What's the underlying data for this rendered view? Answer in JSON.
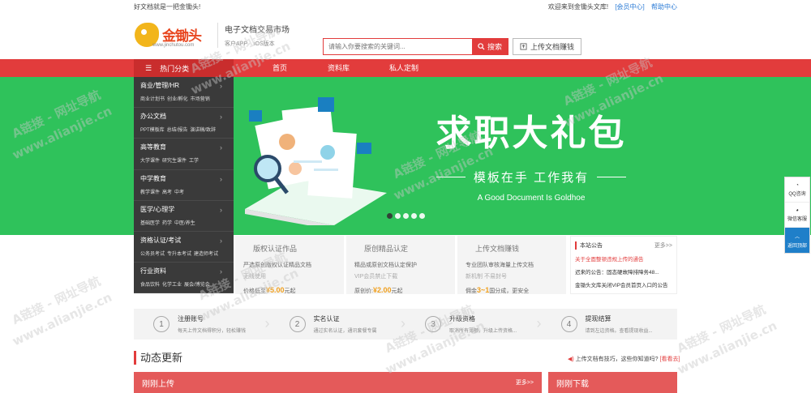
{
  "topbar": {
    "left": "好文档就是一把金锄头!",
    "welcome": "欢迎来到金锄头文库!",
    "member": "[会员中心]",
    "help": "帮助中心"
  },
  "logo": {
    "name": "金锄头",
    "url": "www.jinchutou.com"
  },
  "slogan": {
    "title": "电子文档交易市场",
    "app": "客户APP",
    "ios": "iOS版本"
  },
  "search": {
    "placeholder": "请输入你要搜索的关键词...",
    "button": "搜索"
  },
  "upload": {
    "label": "上传文档赚钱"
  },
  "nav": {
    "category": "热门分类",
    "items": [
      "首页",
      "资料库",
      "私人定制"
    ]
  },
  "sidebar": [
    {
      "title": "商业/管理/HR",
      "subs": [
        "商业计划书",
        "创业/孵化",
        "市场营销"
      ]
    },
    {
      "title": "办公文档",
      "subs": [
        "PPT模板库",
        "总结/报告",
        "演讲稿/致辞"
      ]
    },
    {
      "title": "高等教育",
      "subs": [
        "大学课件",
        "研究生课件",
        "工学"
      ]
    },
    {
      "title": "中学教育",
      "subs": [
        "教学课件",
        "高考",
        "中考"
      ]
    },
    {
      "title": "医学/心理学",
      "subs": [
        "基础医学",
        "药学",
        "中医/养生"
      ]
    },
    {
      "title": "资格认证/考试",
      "subs": [
        "公务员考试",
        "专升本考试",
        "建造师考试"
      ]
    },
    {
      "title": "行业资料",
      "subs": [
        "食品饮料",
        "化学工业",
        "展会/博览会"
      ]
    }
  ],
  "banner": {
    "title": "求职大礼包",
    "subtitle": "模板在手  工作我有",
    "english": "A Good Document Is Goldhoe",
    "dots": 5,
    "active_dot": 0
  },
  "features": [
    {
      "title": "版权认证作品",
      "line1": "严选原创版权认证精品文档",
      "line2": "无线使用",
      "price_label": "价格低至",
      "price": "¥5.00",
      "unit": "元起"
    },
    {
      "title": "原创精品认定",
      "line1": "精品或原创文档认定保护",
      "line2": "VIP会员禁止下载",
      "price_label": "原创价:",
      "price": "¥2.00",
      "unit": "元起"
    },
    {
      "title": "上传文档赚钱",
      "line1": "专业团队审核海量上传文档",
      "line2": "新机制  不易封号",
      "price_label": "佣金",
      "price": "3~1",
      "unit": "国分成，更安全"
    }
  ],
  "notice": {
    "title": "本站公告",
    "more": "更多>>",
    "items": [
      "关于全面整顿违规上传的通告",
      "迟来的公告：固态硬故障排障务48...",
      "金锄头文库关闭VIP会员首页入口的公告"
    ]
  },
  "steps": [
    {
      "num": "1",
      "title": "注册账号",
      "desc": "每天上传文档得积分，轻松赚钱"
    },
    {
      "num": "2",
      "title": "实名认证",
      "desc": "通过实名认证，通讯套餐专属"
    },
    {
      "num": "3",
      "title": "升级资格",
      "desc": "取消所有薄额，升级上传资格..."
    },
    {
      "num": "4",
      "title": "提现结算",
      "desc": "请到左边资格。查看提现收益..."
    }
  ],
  "dynamic": {
    "title": "动态更新",
    "tip": "上传文档有技巧，这些你知道吗?",
    "tip_link": "[看看去]"
  },
  "recent_upload": {
    "title": "刚刚上传",
    "more": "更多>>"
  },
  "recent_download": {
    "title": "刚刚下载"
  },
  "floatbar": {
    "qq": "QQ咨询",
    "wechat": "微信客服",
    "top": "返回顶部"
  },
  "watermark": {
    "cn": "A链接 - 网址导航",
    "en": "www.alianjie.cn"
  },
  "colors": {
    "brand_red": "#e23c3c",
    "banner_green": "#2fc25b",
    "sidebar_dark": "#3a3a3a"
  }
}
